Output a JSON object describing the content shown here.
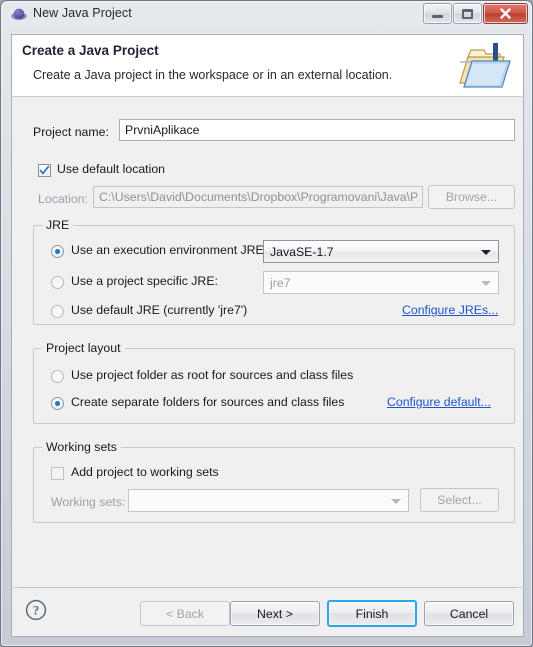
{
  "window": {
    "title": "New Java Project",
    "title_icon": "java-project-icon",
    "caption": {
      "minimize": "minimize-button",
      "maximize": "maximize-button",
      "close": "close-button"
    }
  },
  "header": {
    "title": "Create a Java Project",
    "description": "Create a Java project in the workspace or in an external location.",
    "icon": "new-java-project-banner-icon"
  },
  "form": {
    "project_name_label": "Project name:",
    "project_name_value": "PrvniAplikace",
    "project_name_placeholder": "",
    "use_default_location_label": "Use default location",
    "use_default_location_checked": true,
    "location_label": "Location:",
    "location_value": "C:\\Users\\David\\Documents\\Dropbox\\Programovani\\Java\\P",
    "browse_label": "Browse...",
    "browse_enabled": false
  },
  "jre": {
    "group_title": "JRE",
    "option_execution_env_label": "Use an execution environment JRE:",
    "option_execution_env_selected": true,
    "execution_env_value": "JavaSE-1.7",
    "option_project_specific_label": "Use a project specific JRE:",
    "option_project_specific_selected": false,
    "project_specific_value": "jre7",
    "option_default_jre_label": "Use default JRE (currently 'jre7')",
    "option_default_jre_selected": false,
    "configure_link": "Configure JREs..."
  },
  "project_layout": {
    "group_title": "Project layout",
    "option_root_label": "Use project folder as root for sources and class files",
    "option_root_selected": false,
    "option_separate_label": "Create separate folders for sources and class files",
    "option_separate_selected": true,
    "configure_link": "Configure default..."
  },
  "working_sets": {
    "group_title": "Working sets",
    "add_checkbox_label": "Add project to working sets",
    "add_checkbox_checked": false,
    "working_sets_label": "Working sets:",
    "working_sets_value": "",
    "select_label": "Select...",
    "select_enabled": false
  },
  "footer": {
    "help_icon": "help-icon",
    "back_label": "< Back",
    "back_enabled": false,
    "next_label": "Next >",
    "finish_label": "Finish",
    "finish_focused": true,
    "cancel_label": "Cancel"
  },
  "colors": {
    "accent_link": "#1f55c9",
    "focus_ring": "#2ba6e4",
    "radio_dot": "#1878c8",
    "close_button": "#bb3f32",
    "body_background": "#f0f0f0"
  }
}
